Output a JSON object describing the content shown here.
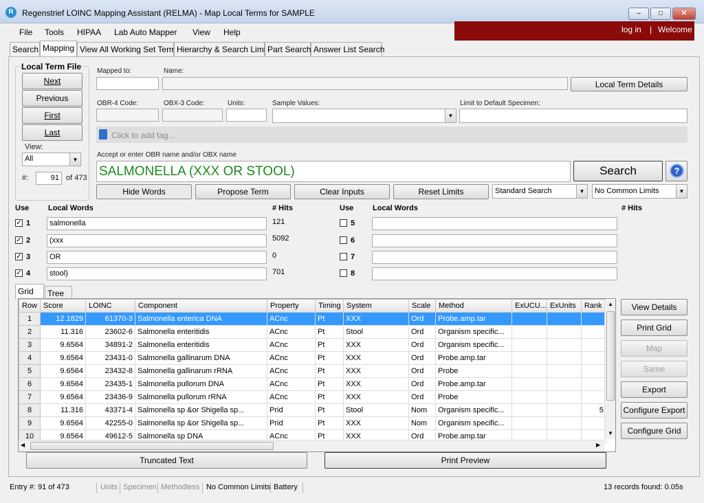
{
  "window": {
    "title": "Regenstrief LOINC Mapping Assistant (RELMA) - Map Local Terms  for SAMPLE",
    "minimize": "–",
    "maximize": "□",
    "close": "✕"
  },
  "menu": [
    "File",
    "Tools",
    "HIPAA",
    "Lab Auto Mapper",
    "View",
    "Help"
  ],
  "account": {
    "login": "log in",
    "separator": "|",
    "welcome": "Welcome"
  },
  "tabs": [
    "Search",
    "Mapping",
    "View All Working Set Terms",
    "Hierarchy & Search Limits",
    "Part Search",
    "Answer List Search"
  ],
  "local_term_file": {
    "title": "Local Term File",
    "next": "Next",
    "previous": "Previous",
    "first": "First",
    "last": "Last",
    "view_label": "View:",
    "view_value": "All",
    "index_label": "#:",
    "index_value": "91",
    "of_label": "of 473"
  },
  "fields": {
    "mapped_to_label": "Mapped to:",
    "mapped_to_value": "",
    "name_label": "Name:",
    "name_value": "",
    "local_term_details": "Local Term Details",
    "obr4_label": "OBR-4 Code:",
    "obx3_label": "OBX-3 Code:",
    "units_label": "Units:",
    "sample_values_label": "Sample Values:",
    "limit_specimen_label": "Limit to Default Specimen:",
    "tag_placeholder": "Click to add tag...",
    "accept_label": "Accept or enter OBR name and/or OBX name",
    "search_text": "SALMONELLA (XXX OR STOOL)",
    "search_button": "Search",
    "help_icon": "?"
  },
  "actions": {
    "hide_words": "Hide Words",
    "propose_term": "Propose Term",
    "clear_inputs": "Clear Inputs",
    "reset_limits": "Reset Limits",
    "search_mode": "Standard Search",
    "common_limits": "No Common Limits"
  },
  "words": {
    "use_label": "Use",
    "local_words_label": "Local Words",
    "hits_label": "# Hits",
    "left": [
      {
        "n": "1",
        "word": "salmonella",
        "hits": "121",
        "checked": "✓"
      },
      {
        "n": "2",
        "word": "(xxx",
        "hits": "5092",
        "checked": "✓"
      },
      {
        "n": "3",
        "word": "OR",
        "hits": "0",
        "checked": "✓"
      },
      {
        "n": "4",
        "word": "stool)",
        "hits": "701",
        "checked": "✓"
      }
    ],
    "right": [
      {
        "n": "5",
        "word": "",
        "hits": ""
      },
      {
        "n": "6",
        "word": "",
        "hits": ""
      },
      {
        "n": "7",
        "word": "",
        "hits": ""
      },
      {
        "n": "8",
        "word": "",
        "hits": ""
      }
    ]
  },
  "result_tabs": [
    "Grid",
    "Tree"
  ],
  "grid": {
    "columns": [
      "Row",
      "Score",
      "LOINC",
      "Component",
      "Property",
      "Timing",
      "System",
      "Scale",
      "Method",
      "ExUCU...",
      "ExUnits",
      "Rank"
    ],
    "rows": [
      [
        "1",
        "12.1829",
        "61370-3",
        "Salmonella enterica DNA",
        "ACnc",
        "Pt",
        "XXX",
        "Ord",
        "Probe.amp.tar",
        "",
        "",
        ""
      ],
      [
        "2",
        "11.316",
        "23602-6",
        "Salmonella enteritidis",
        "ACnc",
        "Pt",
        "Stool",
        "Ord",
        "Organism specific...",
        "",
        "",
        ""
      ],
      [
        "3",
        "9.6564",
        "34891-2",
        "Salmonella enteritidis",
        "ACnc",
        "Pt",
        "XXX",
        "Ord",
        "Organism specific...",
        "",
        "",
        ""
      ],
      [
        "4",
        "9.6564",
        "23431-0",
        "Salmonella gallinarum DNA",
        "ACnc",
        "Pt",
        "XXX",
        "Ord",
        "Probe.amp.tar",
        "",
        "",
        ""
      ],
      [
        "5",
        "9.6564",
        "23432-8",
        "Salmonella gallinarum rRNA",
        "ACnc",
        "Pt",
        "XXX",
        "Ord",
        "Probe",
        "",
        "",
        ""
      ],
      [
        "6",
        "9.6564",
        "23435-1",
        "Salmonella pullorum DNA",
        "ACnc",
        "Pt",
        "XXX",
        "Ord",
        "Probe.amp.tar",
        "",
        "",
        ""
      ],
      [
        "7",
        "9.6564",
        "23436-9",
        "Salmonella pullorum rRNA",
        "ACnc",
        "Pt",
        "XXX",
        "Ord",
        "Probe",
        "",
        "",
        ""
      ],
      [
        "8",
        "11.316",
        "43371-4",
        "Salmonella sp &or Shigella sp...",
        "Prid",
        "Pt",
        "Stool",
        "Nom",
        "Organism specific...",
        "",
        "",
        "5"
      ],
      [
        "9",
        "9.6564",
        "42255-0",
        "Salmonella sp &or Shigella sp...",
        "Prid",
        "Pt",
        "XXX",
        "Nom",
        "Organism specific...",
        "",
        "",
        ""
      ],
      [
        "10",
        "9.6564",
        "49612-5",
        "Salmonella sp DNA",
        "ACnc",
        "Pt",
        "XXX",
        "Ord",
        "Probe.amp.tar",
        "",
        "",
        ""
      ]
    ],
    "selected_row": "1"
  },
  "side_buttons": {
    "view_details": "View Details",
    "print_grid": "Print Grid",
    "map": "Map",
    "same": "Same",
    "export": "Export",
    "configure_export": "Configure Export",
    "configure_grid": "Configure Grid"
  },
  "bottom": {
    "truncated_text": "Truncated Text",
    "print_preview": "Print Preview"
  },
  "status": {
    "entry": "Entry #: 91 of 473",
    "units": "Units",
    "specimen": "Specimen",
    "methodless": "Methodless",
    "common_limits": "No Common Limits",
    "battery": "Battery",
    "records": "13 records found: 0.05s"
  }
}
